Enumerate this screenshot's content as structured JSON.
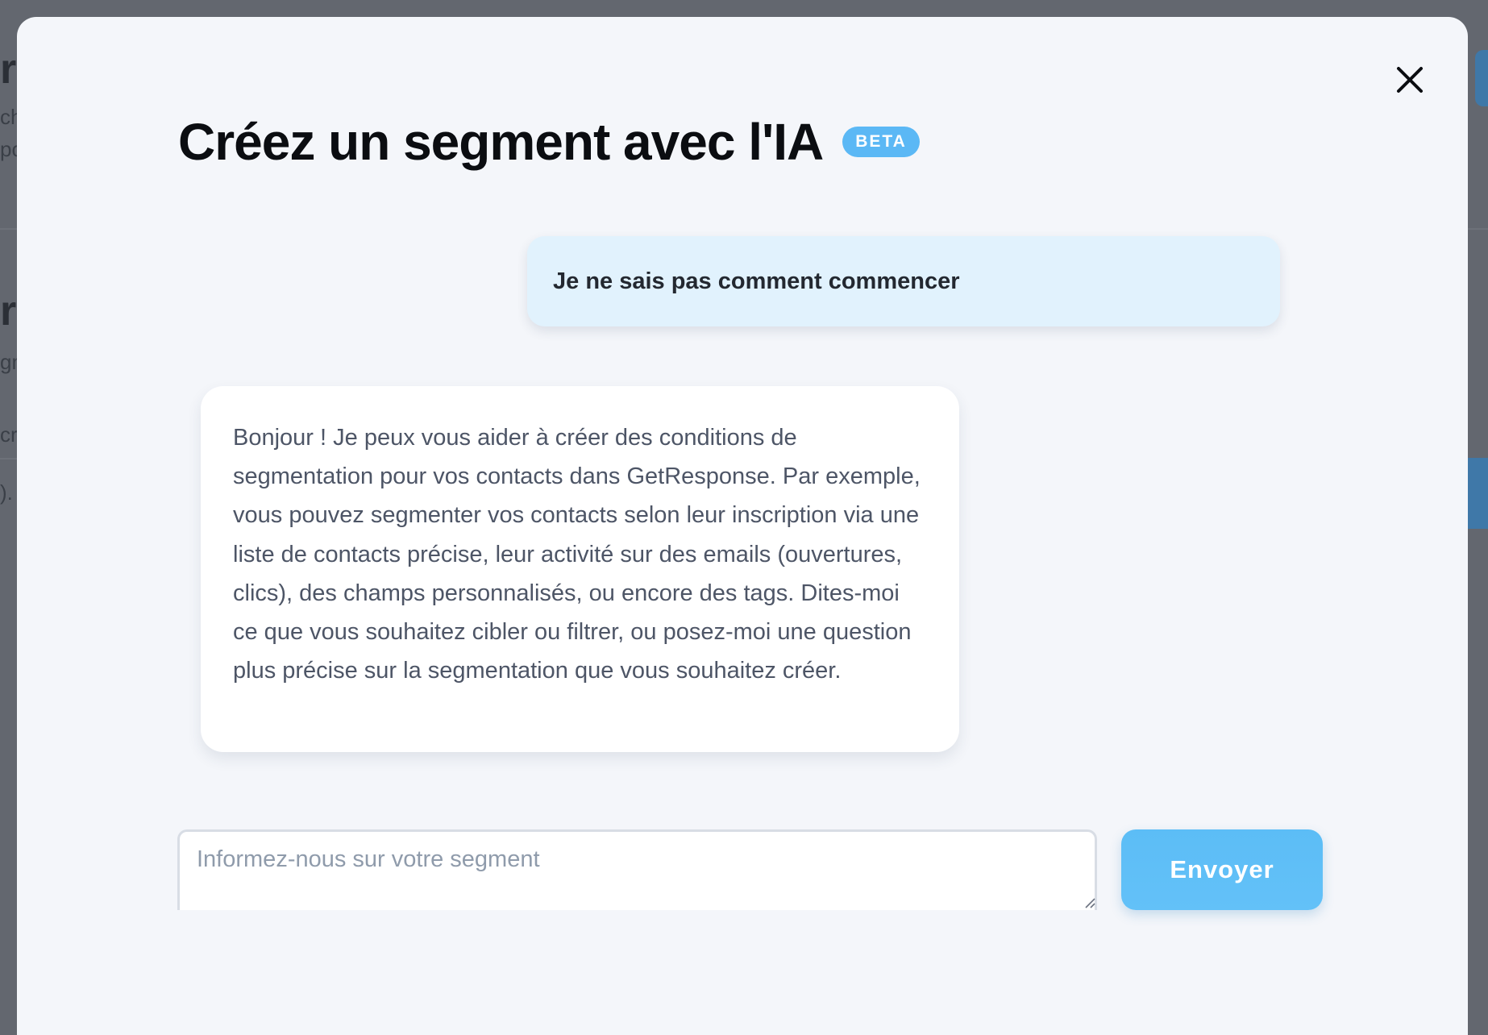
{
  "modal": {
    "title": "Créez un segment avec l'IA",
    "badge": "BETA",
    "close_icon": "close-icon"
  },
  "chat": {
    "messages": [
      {
        "role": "user",
        "text": "Je ne sais pas comment commencer"
      },
      {
        "role": "assistant",
        "text": "Bonjour ! Je peux vous aider à créer des conditions de segmentation pour vos contacts dans GetResponse. Par exemple, vous pouvez segmenter vos contacts selon leur inscription via une liste de contacts précise, leur activité sur des emails (ouvertures, clics), des champs personnalisés, ou encore des tags. Dites-moi ce que vous souhaitez cibler ou filtrer, ou posez-moi une question plus précise sur la segmentation que vous souhaitez créer."
      }
    ]
  },
  "composer": {
    "placeholder": "Informez-nous sur votre segment",
    "value": "",
    "send_label": "Envoyer"
  },
  "colors": {
    "accent": "#5bb8f5",
    "user_bubble": "#e1f2fd",
    "modal_bg": "#f4f6fa",
    "overlay": "#63676f"
  }
}
